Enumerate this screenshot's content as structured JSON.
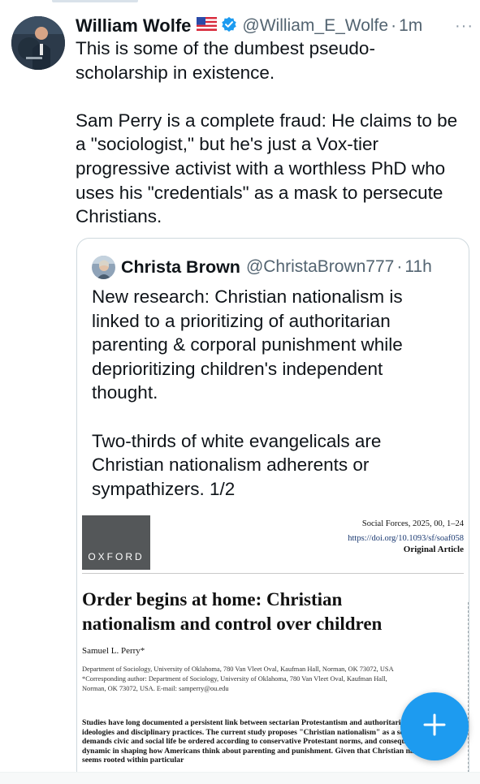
{
  "tweet": {
    "author_name": "William Wolfe",
    "handle": "@William_E_Wolfe",
    "separator": "·",
    "time": "1m",
    "more_label": "···",
    "text": "This is some of the dumbest pseudo-\nscholarship in existence.\n\nSam Perry is a complete fraud: He claims to be\na \"sociologist,\" but he's just a Vox-tier\nprogressive activist with a worthless PhD who\nuses his \"credentials\" as a mask to persecute\nChristians."
  },
  "quote": {
    "author_name": "Christa Brown",
    "handle": "@ChristaBrown777",
    "separator": "·",
    "time": "11h",
    "text": "New research: Christian nationalism is\nlinked to a prioritizing of authoritarian\nparenting & corporal punishment while\ndeprioritizing children's independent\nthought.\n\nTwo-thirds of white evangelicals are\nChristian nationalism adherents or\nsympathizers. 1/2"
  },
  "paper": {
    "publisher_logo": "OXFORD",
    "journal": "Social Forces, 2025, 00, 1–24",
    "doi": "https://doi.org/10.1093/sf/soaf058",
    "article_type": "Original Article",
    "title": "Order begins at home: Christian\nnationalism and control over children",
    "author": "Samuel L. Perry*",
    "affiliation": "Department of Sociology, University of Oklahoma, 780 Van Vleet Oval, Kaufman Hall, Norman, OK 73072, USA\n*Corresponding author: Department of Sociology, University of Oklahoma, 780 Van Vleet Oval, Kaufman Hall,\nNorman, OK 73072, USA. E-mail: samperry@ou.edu",
    "abstract": "Studies have long documented a persistent link between sectarian Protestantism and authoritarian parenting ideologies and disciplinary practices. The current study proposes \"Christian nationalism\" as a schema that demands civic and social life be ordered according to conservative Protestant norms, and consequently, a key dynamic in shaping how Americans think about parenting and punishment. Given that Christian nationalism seems rooted within particular"
  },
  "icons": {
    "flag": "us-flag-icon",
    "verified": "verified-badge-icon",
    "more": "more-horizontal-icon",
    "compose": "plus-icon"
  },
  "colors": {
    "accent": "#1d9bf0",
    "secondary_text": "#536471",
    "border": "#cfd9de"
  }
}
